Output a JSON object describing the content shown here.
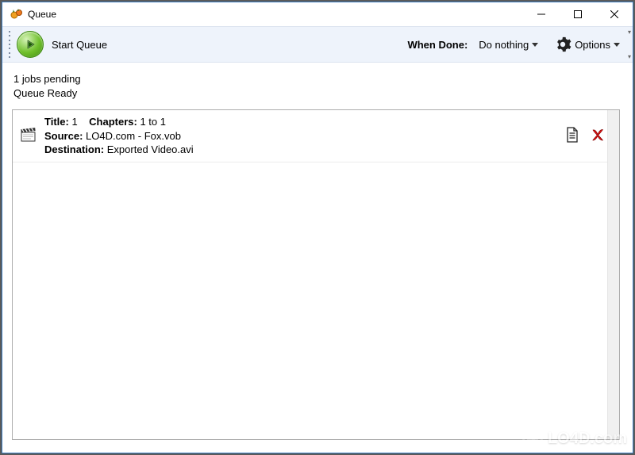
{
  "window": {
    "title": "Queue"
  },
  "toolbar": {
    "start_label": "Start Queue",
    "when_done_label": "When Done:",
    "when_done_value": "Do nothing",
    "options_label": "Options"
  },
  "status": {
    "pending": "1 jobs pending",
    "ready": "Queue Ready"
  },
  "job": {
    "title_label": "Title:",
    "title_value": "1",
    "chapters_label": "Chapters:",
    "chapters_value": "1  to  1",
    "source_label": "Source:",
    "source_value": "LO4D.com - Fox.vob",
    "destination_label": "Destination:",
    "destination_value": "Exported Video.avi"
  },
  "watermark": {
    "text": "LO4D.com"
  }
}
